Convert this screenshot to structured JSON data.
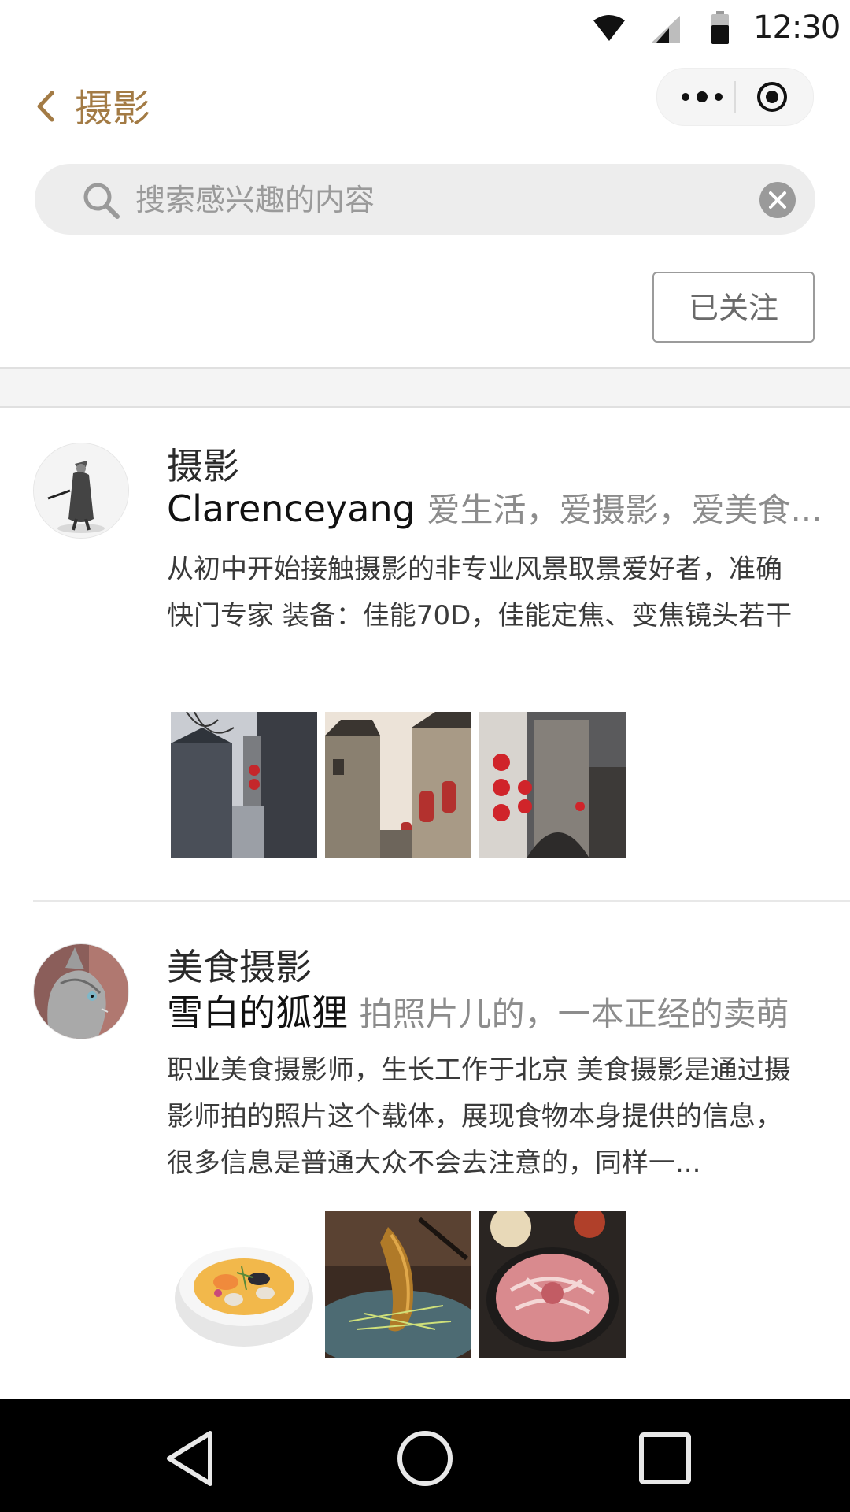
{
  "status_bar": {
    "time": "12:30",
    "icons": [
      "wifi-icon",
      "cellular-signal-icon",
      "battery-icon"
    ]
  },
  "nav": {
    "title": "摄影",
    "back_icon": "chevron-left-icon",
    "more_icon": "more-dots-icon",
    "close_icon": "target-circle-icon",
    "accent": "#a37b45"
  },
  "search": {
    "placeholder": "搜索感兴趣的内容",
    "value": "",
    "icon": "search-icon",
    "clear_icon": "clear-circle-icon"
  },
  "follow_button": {
    "label": "已关注"
  },
  "feed": [
    {
      "category": "摄影",
      "username": "Clarenceyang",
      "tagline": "爱生活，爱摄影，爱美食...",
      "description": "从初中开始接触摄影的非专业风景取景爱好者，准确快门专家 装备：佳能70D，佳能定焦、变焦镜头若干",
      "avatar": "avatar-ink-warrior",
      "images": [
        "old-town-alley-photo",
        "hui-style-houses-lanterns-photo",
        "red-lanterns-street-photo"
      ]
    },
    {
      "category": "美食摄影",
      "username": "雪白的狐狸",
      "tagline": "拍照片儿的，一本正经的卖萌",
      "description": "职业美食摄影师，生长工作于北京 美食摄影是通过摄影师拍的照片这个载体，展现食物本身提供的信息，很多信息是普通大众不会去注意的，同样一...",
      "avatar": "avatar-cat",
      "images": [
        "seafood-soup-bowl-photo",
        "grilled-shrimp-plate-photo",
        "sliced-beef-hotpot-photo"
      ]
    }
  ],
  "system_nav": {
    "icons": [
      "back-triangle-icon",
      "home-circle-icon",
      "recents-square-icon"
    ]
  }
}
